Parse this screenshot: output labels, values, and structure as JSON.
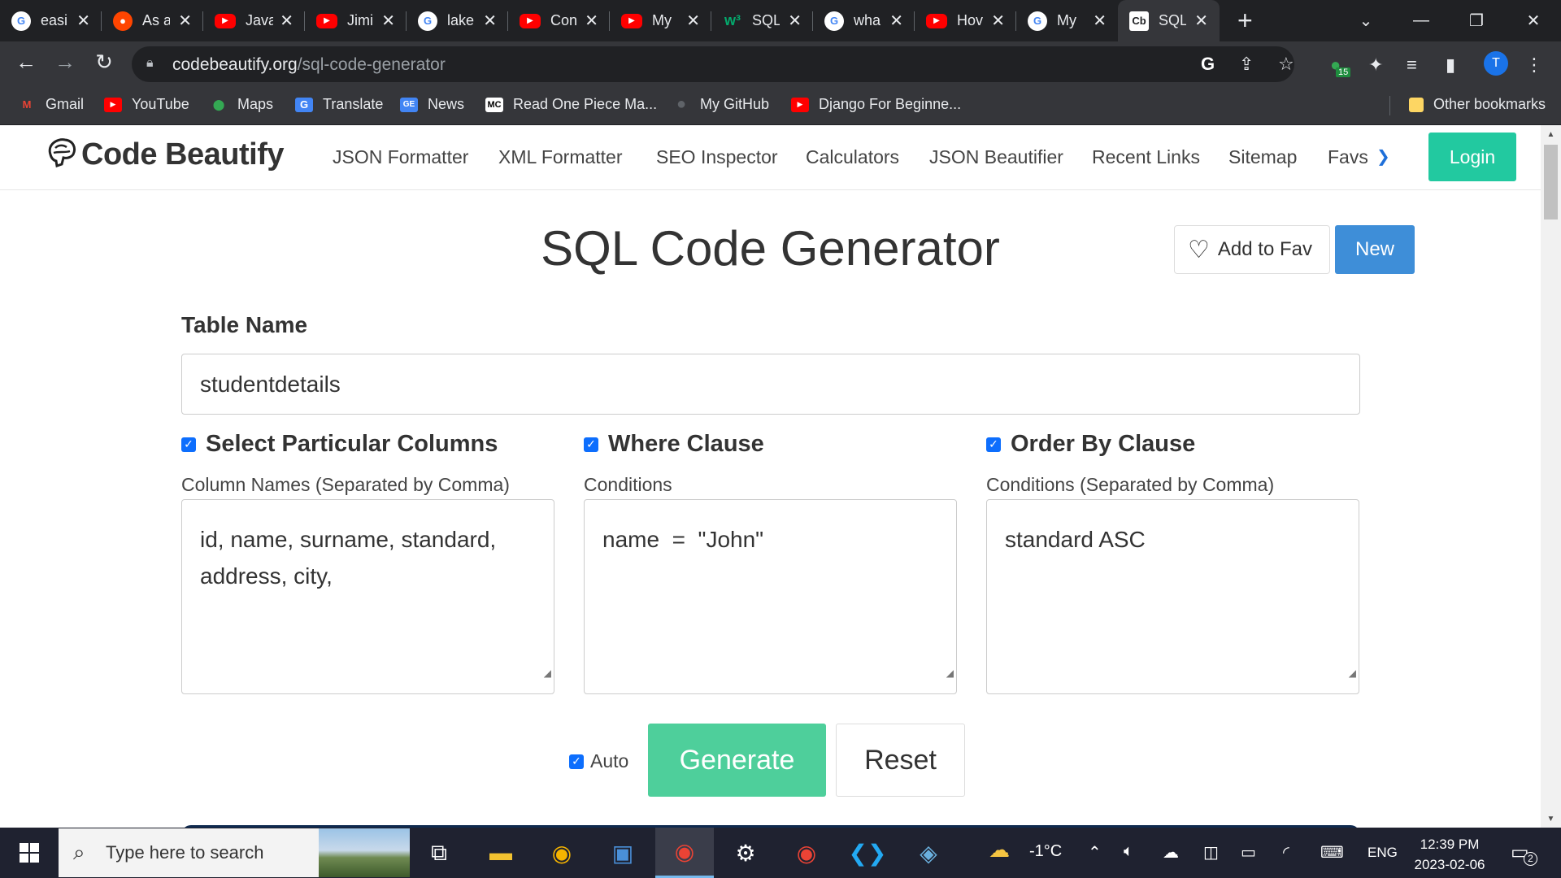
{
  "browser": {
    "tabs": [
      {
        "title": "easi",
        "favicon": "google-icon"
      },
      {
        "title": "As a",
        "favicon": "reddit-icon"
      },
      {
        "title": "Java",
        "favicon": "youtube-icon"
      },
      {
        "title": "Jimi",
        "favicon": "youtube-icon"
      },
      {
        "title": "lake",
        "favicon": "google-icon"
      },
      {
        "title": "Con",
        "favicon": "youtube-icon"
      },
      {
        "title": "My",
        "favicon": "youtube-icon"
      },
      {
        "title": "SQL",
        "favicon": "w3schools-icon"
      },
      {
        "title": "wha",
        "favicon": "google-icon"
      },
      {
        "title": "Hov",
        "favicon": "youtube-icon"
      },
      {
        "title": "My",
        "favicon": "google-icon"
      },
      {
        "title": "SQL",
        "favicon": "codebeautify-icon",
        "active": true
      }
    ],
    "url_host": "codebeautify.org",
    "url_path": "/sql-code-generator",
    "extension_badge": "15",
    "profile_initial": "T",
    "bookmarks": [
      {
        "label": "Gmail",
        "icon": "gmail-icon"
      },
      {
        "label": "YouTube",
        "icon": "youtube-icon"
      },
      {
        "label": "Maps",
        "icon": "maps-icon"
      },
      {
        "label": "Translate",
        "icon": "translate-icon"
      },
      {
        "label": "News",
        "icon": "news-icon"
      },
      {
        "label": "Read One Piece Ma...",
        "icon": "mc-icon"
      },
      {
        "label": "My GitHub",
        "icon": "github-icon"
      },
      {
        "label": "Django For Beginne...",
        "icon": "youtube-icon"
      }
    ],
    "other_bookmarks": "Other bookmarks"
  },
  "site": {
    "logo_text": "Code Beautify",
    "nav": [
      "JSON Formatter",
      "XML Formatter",
      "SEO Inspector",
      "Calculators",
      "JSON Beautifier",
      "Recent Links",
      "Sitemap",
      "Favs"
    ],
    "login": "Login"
  },
  "main": {
    "title": "SQL Code Generator",
    "add_to_fav": "Add to Fav",
    "new": "New",
    "table_name_label": "Table Name",
    "table_name_value": "studentdetails",
    "columns": {
      "check_label": "Select Particular Columns",
      "sublabel": "Column Names (Separated by Comma)",
      "value_line1": "id, name, surname, standard,",
      "value_line2": "address, city,"
    },
    "where": {
      "check_label": "Where Clause",
      "sublabel": "Conditions",
      "value": "name  =  \"John\""
    },
    "order": {
      "check_label": "Order By Clause",
      "sublabel": "Conditions (Separated by Comma)",
      "value": "standard ASC"
    },
    "auto_label": "Auto",
    "generate": "Generate",
    "reset": "Reset"
  },
  "taskbar": {
    "search_placeholder": "Type here to search",
    "weather": "-1°C",
    "language": "ENG",
    "time": "12:39 PM",
    "date": "2023-02-06",
    "notification_count": "2"
  },
  "colors": {
    "login": "#22c9a0",
    "generate": "#4ecf9b",
    "new": "#3e8ed8",
    "checkbox": "#0d6efd"
  }
}
